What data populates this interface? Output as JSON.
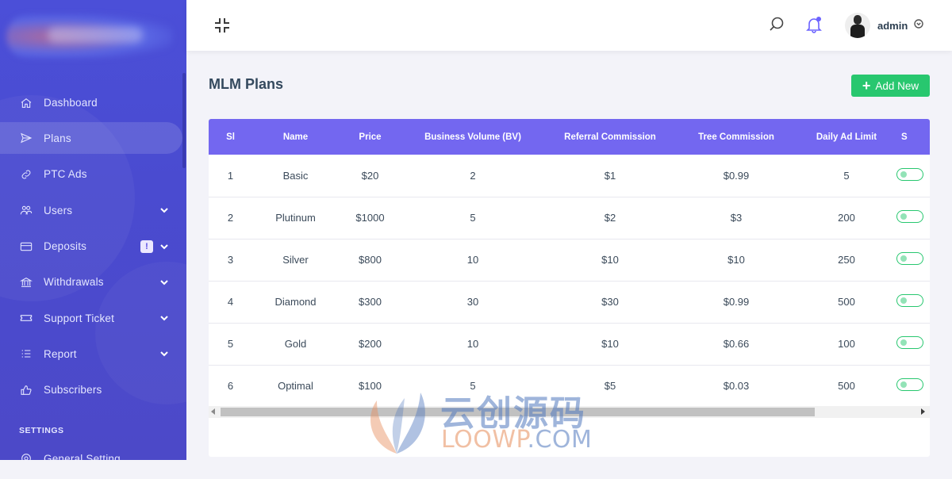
{
  "sidebar": {
    "items": [
      {
        "label": "Dashboard",
        "icon": "home-icon"
      },
      {
        "label": "Plans",
        "icon": "send-icon",
        "active": true
      },
      {
        "label": "PTC Ads",
        "icon": "link-icon"
      },
      {
        "label": "Users",
        "icon": "users-icon",
        "has_submenu": true
      },
      {
        "label": "Deposits",
        "icon": "credit-card-icon",
        "has_submenu": true,
        "badge": "!"
      },
      {
        "label": "Withdrawals",
        "icon": "bank-icon",
        "has_submenu": true
      },
      {
        "label": "Support Ticket",
        "icon": "ticket-icon",
        "has_submenu": true
      },
      {
        "label": "Report",
        "icon": "list-icon",
        "has_submenu": true
      },
      {
        "label": "Subscribers",
        "icon": "thumbs-up-icon"
      }
    ],
    "settings_heading": "SETTINGS",
    "general_setting": {
      "label": "General Setting",
      "icon": "gear-icon"
    }
  },
  "topbar": {
    "user_name": "admin"
  },
  "page": {
    "title": "MLM Plans",
    "add_button": "Add New",
    "add_button_color": "#28c76f",
    "header_color": "#7367f0"
  },
  "table": {
    "columns": [
      "Sl",
      "Name",
      "Price",
      "Business Volume (BV)",
      "Referral Commission",
      "Tree Commission",
      "Daily Ad Limit",
      "S"
    ],
    "rows": [
      [
        "1",
        "Basic",
        "$20",
        "2",
        "$1",
        "$0.99",
        "5"
      ],
      [
        "2",
        "Plutinum",
        "$1000",
        "5",
        "$2",
        "$3",
        "200"
      ],
      [
        "3",
        "Silver",
        "$800",
        "10",
        "$10",
        "$10",
        "250"
      ],
      [
        "4",
        "Diamond",
        "$300",
        "30",
        "$30",
        "$0.99",
        "500"
      ],
      [
        "5",
        "Gold",
        "$200",
        "10",
        "$10",
        "$0.66",
        "100"
      ],
      [
        "6",
        "Optimal",
        "$100",
        "5",
        "$5",
        "$0.03",
        "500"
      ]
    ]
  },
  "watermark": {
    "line1": "云创源码",
    "line2_a": "LOOWP",
    "line2_b": ".COM"
  }
}
